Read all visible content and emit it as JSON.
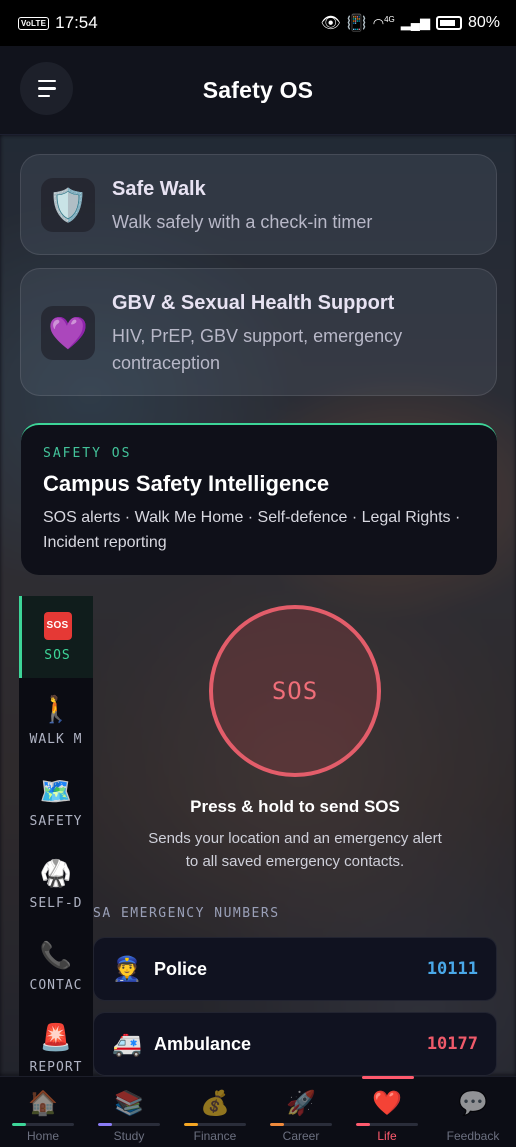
{
  "status_bar": {
    "volte": "VoLTE",
    "time": "17:54",
    "network": "4G",
    "battery": "80%"
  },
  "header": {
    "title": "Safety OS"
  },
  "cards": [
    {
      "icon": "shield-icon",
      "emoji": "🛡️",
      "title": "Safe Walk",
      "subtitle": "Walk safely with a check-in timer"
    },
    {
      "icon": "purple-heart-icon",
      "emoji": "💜",
      "title": "GBV & Sexual Health Support",
      "subtitle": "HIV, PrEP, GBV support, emergency contraception"
    }
  ],
  "intel": {
    "tag": "SAFETY OS",
    "title": "Campus Safety Intelligence",
    "description": "SOS alerts · Walk Me Home · Self-defence · Legal Rights · Incident reporting"
  },
  "sidenav": {
    "items": [
      {
        "icon": "sos-icon",
        "emoji": "SOS",
        "label": "SOS",
        "active": true
      },
      {
        "icon": "walking-person-icon",
        "emoji": "🚶",
        "label": "WALK M"
      },
      {
        "icon": "map-icon",
        "emoji": "🗺️",
        "label": "SAFETY"
      },
      {
        "icon": "martial-arts-uniform-icon",
        "emoji": "🥋",
        "label": "SELF-D"
      },
      {
        "icon": "phone-icon",
        "emoji": "📞",
        "label": "CONTAC"
      },
      {
        "icon": "siren-icon",
        "emoji": "🚨",
        "label": "REPORT"
      }
    ]
  },
  "sos": {
    "button_label": "SOS",
    "title": "Press & hold to send SOS",
    "description": "Sends your location and an emergency alert to all saved emergency contacts."
  },
  "emergency": {
    "heading": "SA EMERGENCY NUMBERS",
    "items": [
      {
        "icon": "police-officer-icon",
        "emoji": "👮",
        "name": "Police",
        "number": "10111",
        "color": "#4aa8e8"
      },
      {
        "icon": "ambulance-icon",
        "emoji": "🚑",
        "name": "Ambulance",
        "number": "10177",
        "color": "#ef5a6a"
      }
    ]
  },
  "bottom_nav": {
    "items": [
      {
        "icon": "home-icon",
        "emoji": "🏠",
        "label": "Home",
        "accent": "#3dd598"
      },
      {
        "icon": "books-icon",
        "emoji": "📚",
        "label": "Study",
        "accent": "#8b7cf6"
      },
      {
        "icon": "money-bag-icon",
        "emoji": "💰",
        "label": "Finance",
        "accent": "#f5a623"
      },
      {
        "icon": "rocket-icon",
        "emoji": "🚀",
        "label": "Career",
        "accent": "#f08a3c"
      },
      {
        "icon": "heart-icon",
        "emoji": "❤️",
        "label": "Life",
        "accent": "#ff5a6e",
        "active": true
      },
      {
        "icon": "speech-bubble-icon",
        "emoji": "💬",
        "label": "Feedback",
        "accent": "#3a3d4a"
      }
    ]
  }
}
